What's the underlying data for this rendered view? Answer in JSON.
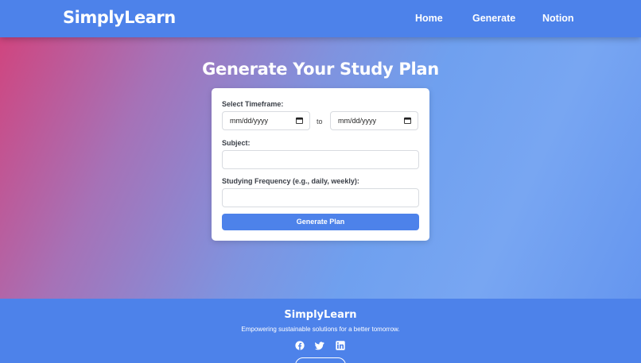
{
  "header": {
    "logo": "SimplyLearn",
    "nav": [
      "Home",
      "Generate",
      "Notion"
    ]
  },
  "main": {
    "title": "Generate Your Study Plan",
    "form": {
      "timeframe_label": "Select Timeframe:",
      "start_date_placeholder": "mm/dd/yyyy",
      "to_text": "to",
      "end_date_placeholder": "mm/dd/yyyy",
      "subject_label": "Subject:",
      "subject_value": "",
      "frequency_label": "Studying Frequency (e.g., daily, weekly):",
      "frequency_value": "",
      "submit_label": "Generate Plan"
    }
  },
  "footer": {
    "logo": "SimplyLearn",
    "tagline": "Empowering sustainable solutions for a better tomorrow.",
    "social_icons": [
      "facebook-icon",
      "twitter-icon",
      "linkedin-icon"
    ]
  },
  "colors": {
    "primary": "#4d82ea",
    "gradient_start": "#d0457f",
    "gradient_end": "#6596ef"
  }
}
